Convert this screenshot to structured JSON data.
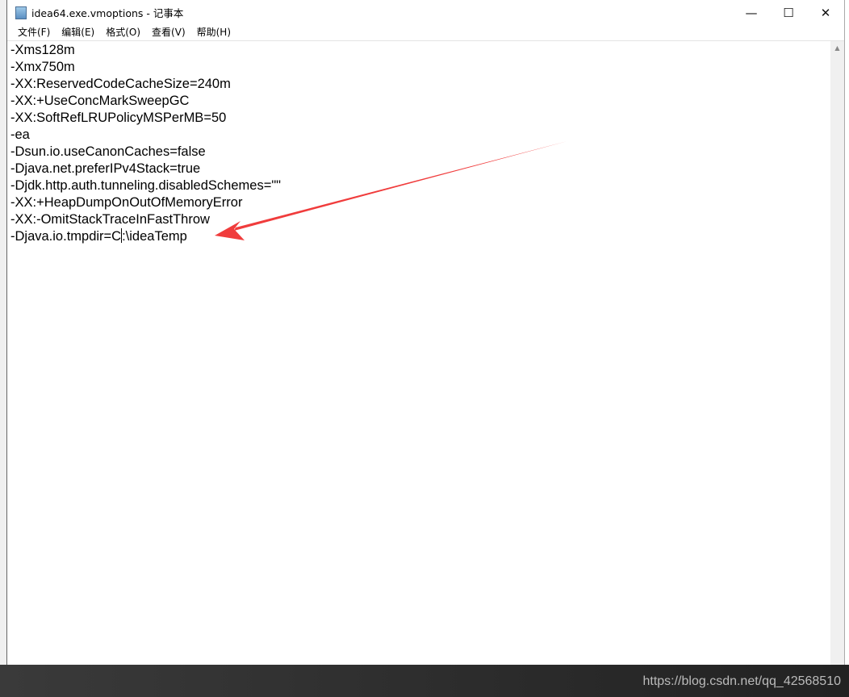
{
  "window": {
    "title": "idea64.exe.vmoptions - 记事本",
    "minimize": "—",
    "maximize": "☐",
    "close": "✕"
  },
  "menu": [
    "文件(F)",
    "编辑(E)",
    "格式(O)",
    "查看(V)",
    "帮助(H)"
  ],
  "editor": {
    "lines": [
      "-Xms128m",
      "-Xmx750m",
      "-XX:ReservedCodeCacheSize=240m",
      "-XX:+UseConcMarkSweepGC",
      "-XX:SoftRefLRUPolicyMSPerMB=50",
      "-ea",
      "-Dsun.io.useCanonCaches=false",
      "-Djava.net.preferIPv4Stack=true",
      "-Djdk.http.auth.tunneling.disabledSchemes=\"\"",
      "-XX:+HeapDumpOnOutOfMemoryError",
      "-XX:-OmitStackTraceInFastThrow"
    ],
    "last_line_before_caret": "-Djava.io.tmpdir=C",
    "last_line_after_caret": ":\\ideaTemp"
  },
  "annotation": {
    "color": "#f03c3c",
    "type": "arrow"
  },
  "watermark": "https://blog.csdn.net/qq_42568510",
  "scroll_up": "▲"
}
